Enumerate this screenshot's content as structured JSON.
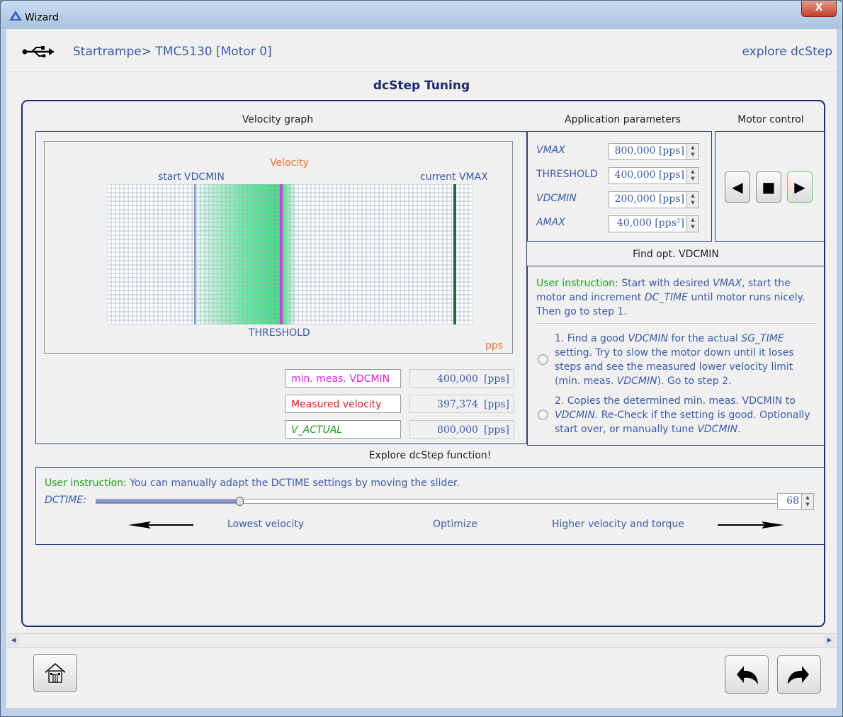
{
  "window": {
    "title": "Wizard",
    "close": "X"
  },
  "header": {
    "breadcrumb": "Startrampe> TMC5130 [Motor 0]",
    "link": "explore dcStep",
    "icon": "usb-icon"
  },
  "page_title": "dcStep Tuning",
  "velocity_graph": {
    "title": "Velocity graph",
    "velocity_label": "Velocity",
    "start_label": "start VDCMIN",
    "vmax_label": "current VMAX",
    "threshold_label": "THRESHOLD",
    "unit_label": "pps",
    "colors": {
      "velocity": "#e8742e",
      "vdcmin_line": "#7b90d6",
      "threshold_line": "#d43ed4",
      "vmax_line": "#1e6b3a",
      "green_fill": "#2fe07a"
    }
  },
  "measurements": [
    {
      "label": "min. meas. VDCMIN",
      "value": "400,000",
      "unit": "[pps]",
      "color": "#e020e0",
      "italic": false
    },
    {
      "label": "Measured velocity",
      "value": "397,374",
      "unit": "[pps]",
      "color": "#e02020",
      "italic": false
    },
    {
      "label": "V_ACTUAL",
      "value": "800,000",
      "unit": "[pps]",
      "color": "#1f9e1f",
      "italic": true
    }
  ],
  "app_params": {
    "title": "Application parameters",
    "rows": [
      {
        "label": "VMAX",
        "value": "800,000 [pps]",
        "italic": true
      },
      {
        "label": "THRESHOLD",
        "value": "400,000 [pps]",
        "italic": false
      },
      {
        "label": "VDCMIN",
        "value": "200,000 [pps]",
        "italic": true
      },
      {
        "label": "AMAX",
        "value": "40,000 [pps²]",
        "italic": true
      }
    ]
  },
  "motor_control": {
    "title": "Motor control",
    "buttons": [
      "play-left-icon",
      "stop-icon",
      "play-right-icon"
    ]
  },
  "find_vdcmin": {
    "title": "Find opt. VDCMIN",
    "instruction_prefix": "User instruction:",
    "instruction_parts": [
      " Start with desired ",
      "VMAX",
      ", start the motor and increment ",
      "DC_TIME",
      " until motor runs nicely. Then go to step 1."
    ],
    "step1_parts": [
      "1. Find a good ",
      "VDCMIN",
      " for the actual ",
      "SG_TIME",
      " setting. Try to slow the motor down until it loses steps and see the measured lower velocity limit (min. meas. ",
      "VDCMIN",
      "). Go to step 2."
    ],
    "step2_parts": [
      "2. Copies the determined min. meas. VDCMIN to ",
      "VDCMIN",
      ". Re-Check if the setting is good. Optionally start over, or manually tune ",
      "VDCMIN",
      "."
    ]
  },
  "explore": {
    "title": "Explore dcStep function!",
    "instruction_prefix": "User instruction:",
    "instruction_text": " You can manually adapt the DCTIME settings by moving the slider.",
    "slider_label": "DCTIME:",
    "slider_value": "68",
    "slider_fraction": 0.21,
    "hint_low": "Lowest velocity",
    "hint_mid": "Optimize",
    "hint_high": "Higher velocity and torque"
  },
  "footer": {
    "home": "home-icon",
    "back": "undo-icon",
    "forward": "redo-icon"
  }
}
